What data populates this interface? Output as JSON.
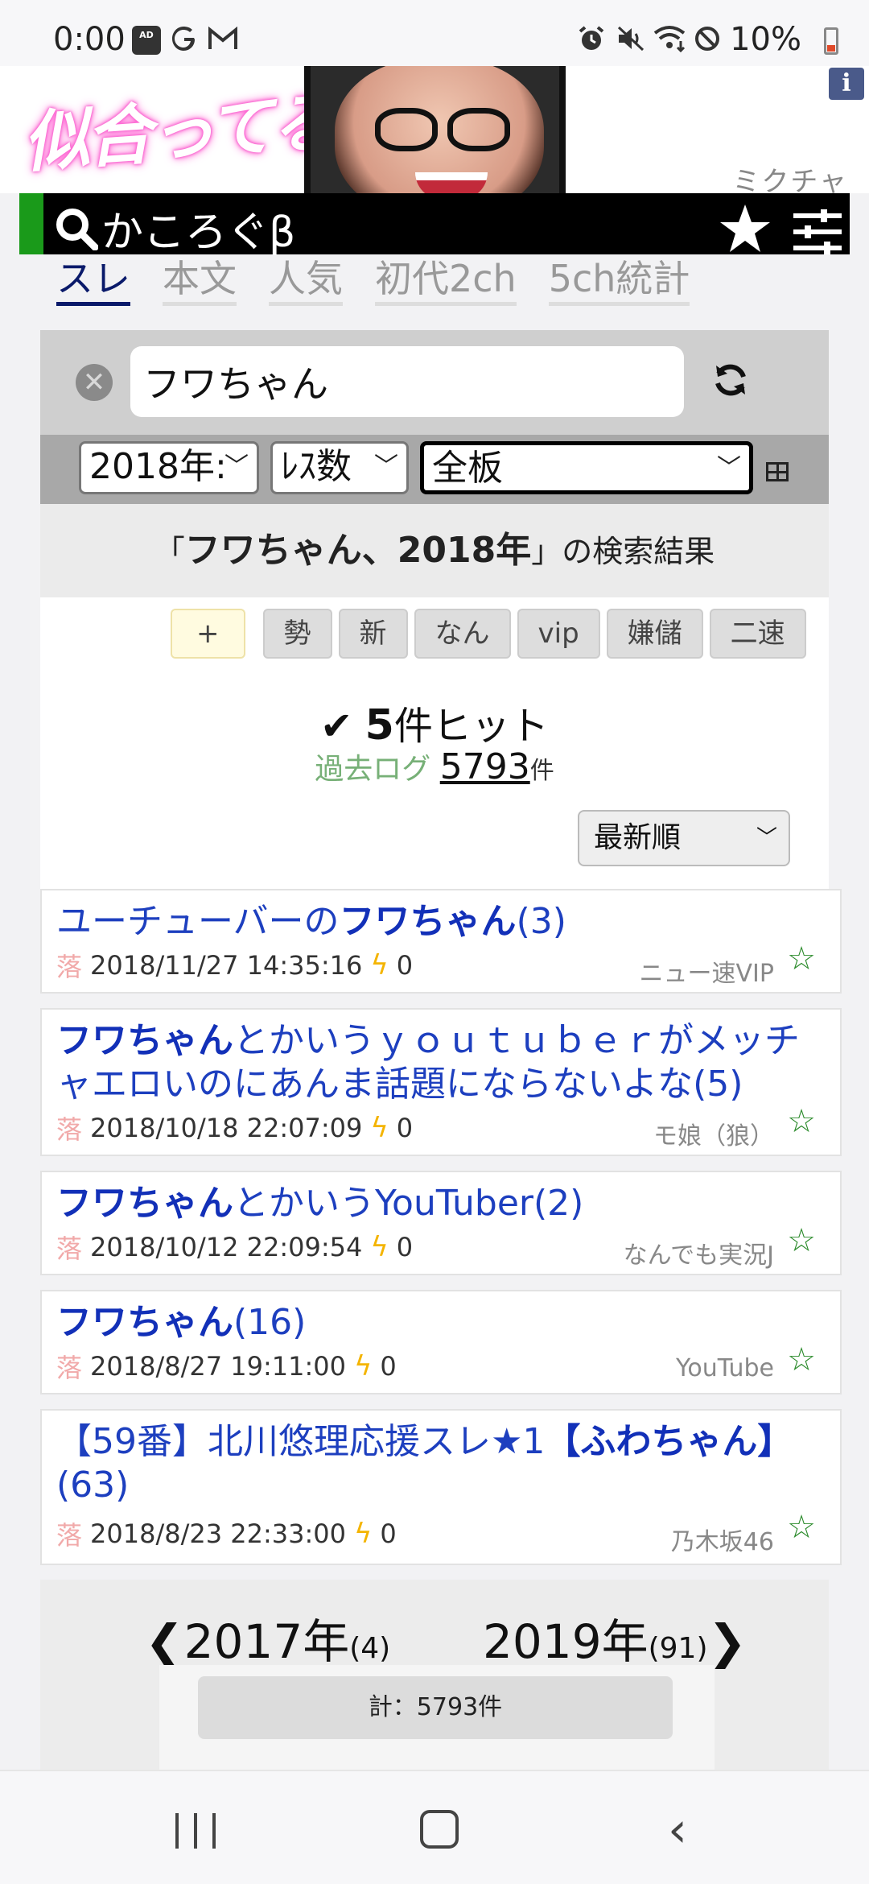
{
  "status_bar": {
    "time": "0:00",
    "adblock_label": "AD",
    "battery": "10%",
    "icons": [
      "adblock-icon",
      "google-icon",
      "gmail-icon",
      "alarm-icon",
      "mute-icon",
      "wifi-icon",
      "dnd-icon",
      "battery-icon"
    ]
  },
  "ad": {
    "tagline": "似合ってる?",
    "brand": "ミクチャ",
    "info": "i"
  },
  "header": {
    "logo": "かころぐβ"
  },
  "tabs": [
    {
      "label": "スレ",
      "active": true
    },
    {
      "label": "本文",
      "active": false
    },
    {
      "label": "人気",
      "active": false
    },
    {
      "label": "初代2ch",
      "active": false
    },
    {
      "label": "5ch統計",
      "active": false
    }
  ],
  "search": {
    "value": "フワちゃん"
  },
  "filters": {
    "year": "2018年:",
    "sort": "ﾚｽ数",
    "board": "全板"
  },
  "result_head": {
    "open": "「",
    "query": "フワちゃん、2018年",
    "close": "」",
    "suffix": "の検索結果"
  },
  "tags": [
    "+",
    "勢",
    "新",
    "なん",
    "vip",
    "嫌儲",
    "二速"
  ],
  "hits": {
    "count": "5",
    "label": "件ヒット",
    "log_label": "過去ログ",
    "log_count": "5793",
    "log_unit": "件"
  },
  "order": "最新順",
  "results": [
    {
      "pre": "ユーチューバーの",
      "bold": "フワちゃん",
      "post": "(3)",
      "fall": "落",
      "date": "2018/11/27 14:35:16",
      "score": "0",
      "board": "ニュー速VIP"
    },
    {
      "pre": "",
      "bold": "フワちゃん",
      "post": "とかいうｙｏｕｔｕｂｅｒがメッチャエロいのにあんま話題にならないよな(5)",
      "fall": "落",
      "date": "2018/10/18 22:07:09",
      "score": "0",
      "board": "モ娘（狼）"
    },
    {
      "pre": "",
      "bold": "フワちゃん",
      "post": "とかいうYouTuber(2)",
      "fall": "落",
      "date": "2018/10/12 22:09:54",
      "score": "0",
      "board": "なんでも実況J"
    },
    {
      "pre": "",
      "bold": "フワちゃん",
      "post": "(16)",
      "fall": "落",
      "date": "2018/8/27 19:11:00",
      "score": "0",
      "board": "YouTube"
    },
    {
      "pre": "【59番】北川悠理応援スレ★1",
      "bold": "【ふわちゃん】",
      "post": "(63)",
      "fall": "落",
      "date": "2018/8/23 22:33:00",
      "score": "0",
      "board": "乃木坂46"
    }
  ],
  "year_nav": {
    "prev_year": "2017年",
    "prev_count": "(4)",
    "next_year": "2019年",
    "next_count": "(91)"
  },
  "total": "計：5793件"
}
